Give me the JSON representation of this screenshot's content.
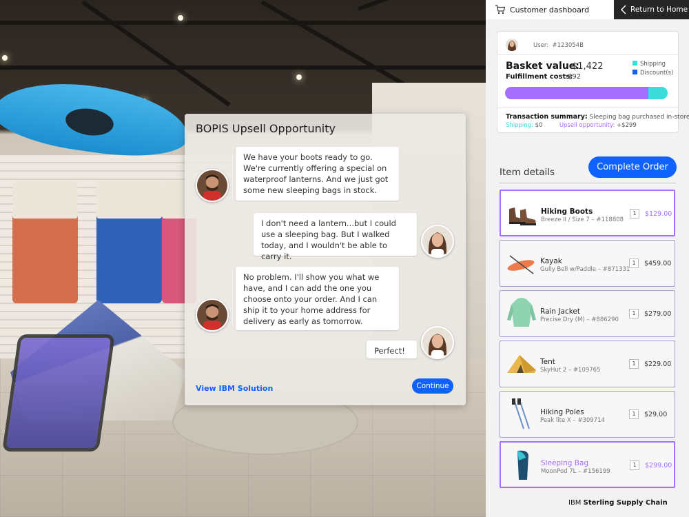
{
  "chat": {
    "title": "BOPIS Upsell Opportunity",
    "messages": [
      {
        "speaker": "associate",
        "text": "We have your boots ready to go. We're currently offering a special on waterproof lanterns. And we just got some new sleeping bags in stock."
      },
      {
        "speaker": "customer",
        "text": "I don't need a lantern...but I could use a sleeping bag. But I walked today, and I wouldn't be able to carry it."
      },
      {
        "speaker": "associate",
        "text": "No problem. I'll show you what we have, and I can add the one you choose onto your order. And I can ship it to your home address for delivery as early as tomorrow."
      },
      {
        "speaker": "customer",
        "text": "Perfect!"
      }
    ],
    "view_solution_label": "View IBM Solution",
    "continue_label": "Continue"
  },
  "topbar": {
    "title": "Customer dashboard",
    "return_label": "Return to Home",
    "cart_icon": "cart-icon",
    "back_icon": "chevron-left-icon"
  },
  "summary": {
    "user_label": "User:",
    "user_id": "#123054B",
    "basket_label": "Basket value:",
    "basket_value": "$1,422",
    "fulfillment_label": "Fulfillment costs:",
    "fulfillment_value": "$92",
    "legend": [
      {
        "label": "Shipping",
        "color": "#3ddbd9"
      },
      {
        "label": "Discount(s)",
        "color": "#0f62fe"
      }
    ],
    "bar": {
      "primary_fraction": 0.88,
      "primary_color": "#a56eff",
      "secondary_fraction": 0.12,
      "secondary_color": "#3ddbd9"
    },
    "transaction_label": "Transaction summary:",
    "transaction_text": "Sleeping bag purchased in-store.",
    "shipping_label": "Shipping:",
    "shipping_value": "$0",
    "upsell_label": "Upsell opportunity:",
    "upsell_value": "+$299"
  },
  "items": {
    "title": "Item details",
    "complete_label": "Complete Order",
    "list": [
      {
        "name": "Hiking Boots",
        "sub": "Breeze II / Size 7 – #118808",
        "qty": "1",
        "price": "$129.00",
        "icon": "boots-icon"
      },
      {
        "name": "Kayak",
        "sub": "Gully Bell w/Paddle – #871331",
        "qty": "1",
        "price": "$459.00",
        "icon": "kayak-icon"
      },
      {
        "name": "Rain Jacket",
        "sub": "Precise Dry (M) – #886290",
        "qty": "1",
        "price": "$279.00",
        "icon": "jacket-icon"
      },
      {
        "name": "Tent",
        "sub": "SkyHut 2 – #109765",
        "qty": "1",
        "price": "$229.00",
        "icon": "tent-icon"
      },
      {
        "name": "Hiking Poles",
        "sub": "Peak lite X – #309714",
        "qty": "1",
        "price": "$29.00",
        "icon": "poles-icon"
      },
      {
        "name": "Sleeping Bag",
        "sub": "MoonPod 7L – #156199",
        "qty": "1",
        "price": "$299.00",
        "icon": "sleeping-bag-icon"
      }
    ]
  },
  "footer": {
    "brand_prefix": "IBM",
    "brand_name": "Sterling Supply Chain"
  },
  "colors": {
    "accent": "#0f62fe",
    "highlight": "#a56eff",
    "teal": "#3ddbd9"
  }
}
